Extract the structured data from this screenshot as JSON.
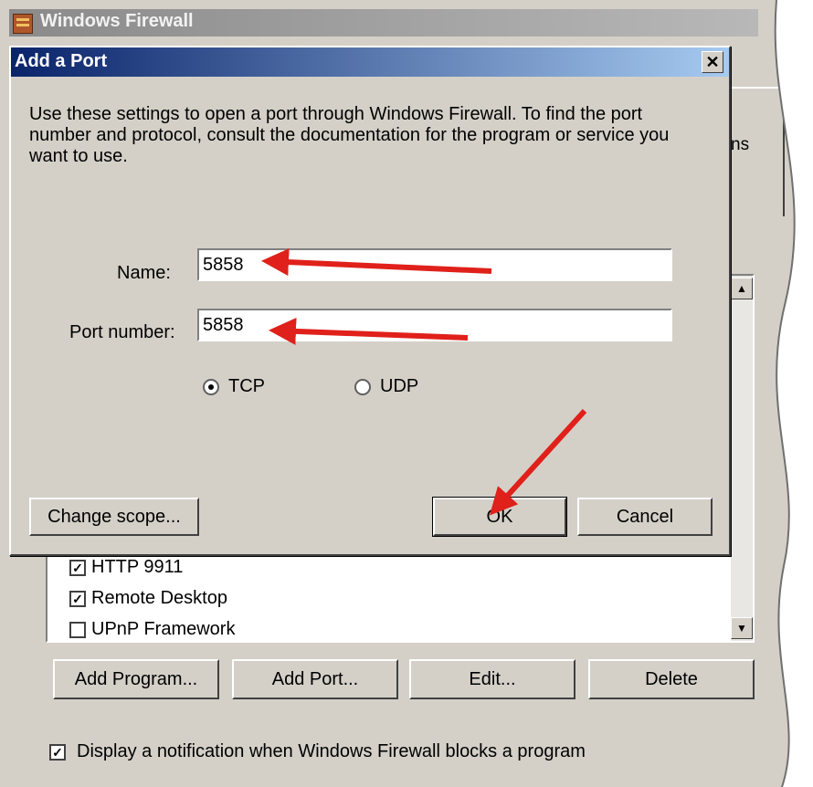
{
  "parent_window": {
    "title": "Windows Firewall",
    "right_tab_fragment": "ns",
    "exceptions": [
      {
        "label": "HTTP 9911",
        "checked": true
      },
      {
        "label": "Remote Desktop",
        "checked": true
      },
      {
        "label": "UPnP Framework",
        "checked": false
      }
    ],
    "buttons": {
      "add_program": "Add Program...",
      "add_port": "Add Port...",
      "edit": "Edit...",
      "delete": "Delete"
    },
    "notification_label": "Display a notification when Windows Firewall blocks a program",
    "notification_checked": true
  },
  "dialog": {
    "title": "Add a Port",
    "close_glyph": "✕",
    "description": "Use these settings to open a port through Windows Firewall. To find the port number and protocol, consult the documentation for the program or service you want to use.",
    "name_label": "Name:",
    "name_value": "5858",
    "port_label": "Port number:",
    "port_value": "5858",
    "protocol_options": [
      {
        "label": "TCP",
        "selected": true
      },
      {
        "label": "UDP",
        "selected": false
      }
    ],
    "buttons": {
      "change_scope": "Change scope...",
      "ok": "OK",
      "cancel": "Cancel"
    }
  },
  "annotation_color": "#e0201a",
  "check_glyph": "✓"
}
